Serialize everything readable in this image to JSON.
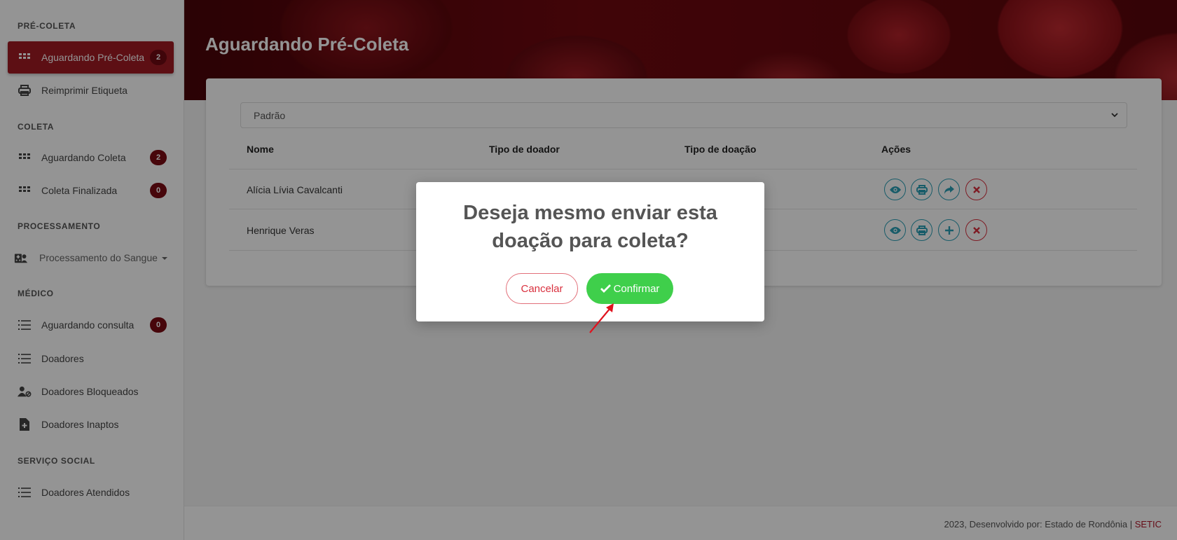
{
  "sidebar": {
    "sections": [
      {
        "title": "PRÉ-COLETA"
      },
      {
        "title": "COLETA"
      },
      {
        "title": "PROCESSAMENTO"
      },
      {
        "title": "MÉDICO"
      },
      {
        "title": "SERVIÇO SOCIAL"
      }
    ],
    "items": [
      {
        "label": "Aguardando Pré-Coleta",
        "badge": "2",
        "icon": "grid-icon",
        "active": true
      },
      {
        "label": "Reimprimir Etiqueta",
        "icon": "printer-icon"
      },
      {
        "label": "Aguardando Coleta",
        "badge": "2",
        "icon": "grid-icon"
      },
      {
        "label": "Coleta Finalizada",
        "badge": "0",
        "icon": "grid-icon"
      },
      {
        "label": "Processamento do Sangue",
        "icon": "hospital-user-icon",
        "dropdown": true
      },
      {
        "label": "Aguardando consulta",
        "badge": "0",
        "icon": "list-icon"
      },
      {
        "label": "Doadores",
        "icon": "list-icon"
      },
      {
        "label": "Doadores Bloqueados",
        "icon": "user-block-icon"
      },
      {
        "label": "Doadores Inaptos",
        "icon": "file-medical-icon"
      },
      {
        "label": "Doadores Atendidos",
        "icon": "list-icon"
      }
    ]
  },
  "header": {
    "title": "Aguardando Pré-Coleta"
  },
  "filter": {
    "selected": "Padrão"
  },
  "table": {
    "columns": [
      "Nome",
      "Tipo de doador",
      "Tipo de doação",
      "Ações"
    ],
    "rows": [
      {
        "nome": "Alícia Lívia Cavalcanti",
        "actions": [
          "eye-icon",
          "printer-icon",
          "share-icon",
          "close-icon"
        ]
      },
      {
        "nome": "Henrique Veras",
        "actions": [
          "eye-icon",
          "printer-icon",
          "plus-icon",
          "close-icon"
        ]
      }
    ]
  },
  "modal": {
    "title": "Deseja mesmo enviar esta doação para coleta?",
    "cancel_label": "Cancelar",
    "confirm_label": "Confirmar"
  },
  "footer": {
    "text": "2023, Desenvolvido por: Estado de Rondônia | ",
    "link": "SETIC"
  },
  "colors": {
    "primary": "#a01a24",
    "badge": "#7a0c14",
    "confirm": "#3fcf4b",
    "cancel": "#d9303e",
    "action_info": "#2a9fb6"
  }
}
